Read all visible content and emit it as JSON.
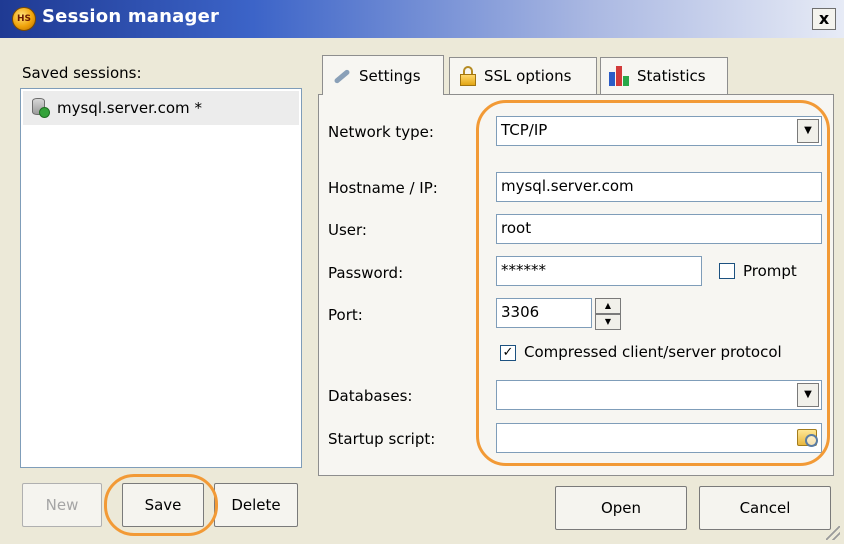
{
  "window": {
    "title": "Session manager",
    "app_icon_text": "HS",
    "close_label": "x"
  },
  "left": {
    "saved_sessions_label": "Saved sessions:",
    "sessions": [
      {
        "label": "mysql.server.com *"
      }
    ],
    "buttons": {
      "new": "New",
      "save": "Save",
      "delete": "Delete"
    }
  },
  "tabs": [
    {
      "label": "Settings",
      "icon": "wrench-icon"
    },
    {
      "label": "SSL options",
      "icon": "lock-icon"
    },
    {
      "label": "Statistics",
      "icon": "bar-chart-icon"
    }
  ],
  "settings": {
    "network_type_label": "Network type:",
    "network_type_value": "TCP/IP",
    "hostname_label": "Hostname / IP:",
    "hostname_value": "mysql.server.com",
    "user_label": "User:",
    "user_value": "root",
    "password_label": "Password:",
    "password_value": "******",
    "prompt_label": "Prompt",
    "prompt_checked": false,
    "port_label": "Port:",
    "port_value": "3306",
    "compressed_label": "Compressed client/server protocol",
    "compressed_checked": true,
    "databases_label": "Databases:",
    "databases_value": "",
    "startup_script_label": "Startup script:",
    "startup_script_value": ""
  },
  "footer": {
    "open": "Open",
    "cancel": "Cancel"
  },
  "colors": {
    "title_bar": "#1f3a93",
    "highlight": "#f29a36",
    "field_border": "#7f9db9"
  }
}
